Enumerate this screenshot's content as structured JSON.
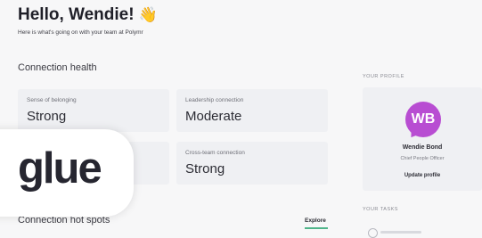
{
  "header": {
    "greeting": "Hello, Wendie!",
    "wave_emoji": "👋",
    "subtitle": "Here is what's going on with your team at Polymr"
  },
  "connection_health": {
    "title": "Connection health",
    "cards": [
      {
        "label": "Sense of belonging",
        "value": "Strong"
      },
      {
        "label": "Leadership connection",
        "value": "Moderate"
      },
      {
        "label": "",
        "value": ""
      },
      {
        "label": "Cross-team connection",
        "value": "Strong"
      }
    ]
  },
  "hot_spots": {
    "title": "Connection hot spots",
    "explore_label": "Explore"
  },
  "profile": {
    "heading": "YOUR PROFILE",
    "initials": "WB",
    "name": "Wendie Bond",
    "role": "Chief People Officer",
    "update_label": "Update profile"
  },
  "tasks": {
    "heading": "YOUR TASKS"
  },
  "logo": {
    "text": "glue"
  },
  "colors": {
    "background": "#f7f7f8",
    "card": "#eff0f3",
    "avatar": "#b84dd2",
    "accent_underline": "#4fb48a"
  }
}
